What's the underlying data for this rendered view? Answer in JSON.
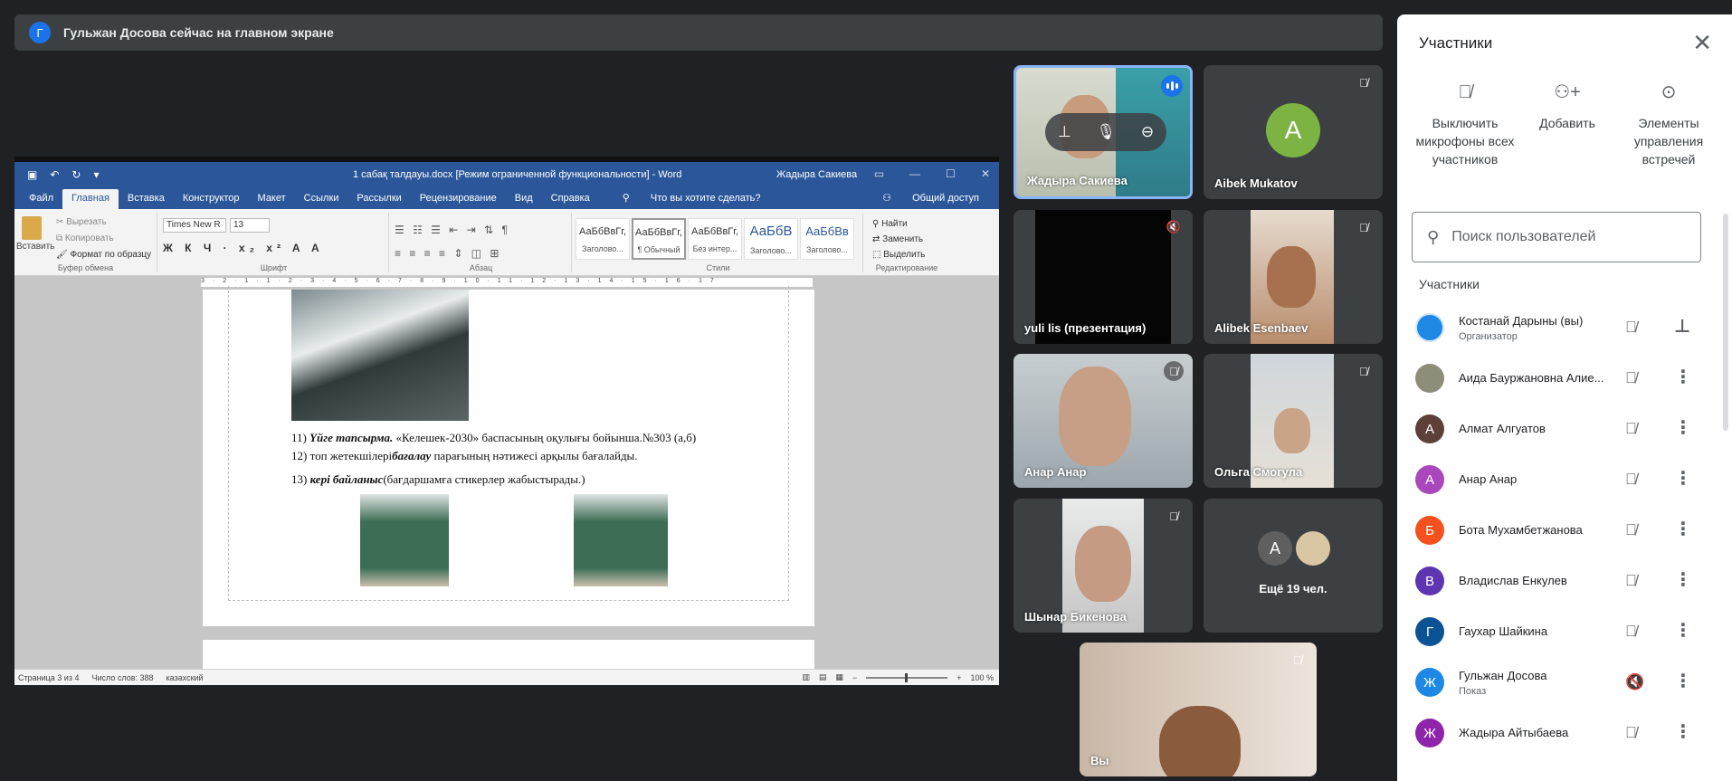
{
  "banner": {
    "avatar_letter": "Г",
    "text": "Гульжан Досова сейчас на главном экране"
  },
  "word": {
    "doc_title": "1 сабақ талдауы.docx [Режим ограниченной функциональности] - Word",
    "user_name": "Жадыра Сакиева",
    "tabs": [
      "Файл",
      "Главная",
      "Вставка",
      "Конструктор",
      "Макет",
      "Ссылки",
      "Рассылки",
      "Рецензирование",
      "Вид",
      "Справка"
    ],
    "tell_me": "Что вы хотите сделать?",
    "share": "Общий доступ",
    "paste_label": "Вставить",
    "cut": "Вырезать",
    "copy": "Копировать",
    "format_painter": "Формат по образцу",
    "clipboard_group": "Буфер обмена",
    "font_name": "Times New R",
    "font_size": "13",
    "font_group": "Шрифт",
    "paragraph_group": "Абзац",
    "styles_group": "Стили",
    "editing_group": "Редактирование",
    "styles": [
      {
        "preview": "АаБбВвГг,",
        "name": "Заголово..."
      },
      {
        "preview": "АаБбВвГг,",
        "name": "¶ Обычный"
      },
      {
        "preview": "АаБбВвГг,",
        "name": "Без интер..."
      },
      {
        "preview": "АаБбВ",
        "name": "Заголово..."
      },
      {
        "preview": "АаБбВв",
        "name": "Заголово..."
      }
    ],
    "find": "Найти",
    "replace": "Заменить",
    "select": "Выделить",
    "lines": [
      {
        "num": "11)",
        "bold": "Үйге тапсырма.",
        "rest": " «Келешек-2030» баспасының оқулығы бойынша.№303 (а,б)"
      },
      {
        "num": "12)",
        "bold": "",
        "plain_before": " топ жетекшілері",
        "bold_mid": "бағалау",
        "rest": " парағының нәтижесі арқылы бағалайды."
      },
      {
        "num": "13)",
        "bold": "кері байланыс",
        "rest": "(бағдаршамға стикерлер жабыстырады.)"
      }
    ],
    "status_page": "Страница 3 из 4",
    "status_words": "Число слов: 388",
    "status_lang": "казахский",
    "zoom": "100 %"
  },
  "tiles": [
    {
      "name": "Жадыра Сакиева"
    },
    {
      "name": "Aibek Mukatov",
      "avatar": "A"
    },
    {
      "name": "yuli lis (презентация)"
    },
    {
      "name": "Alibek Esenbaev"
    },
    {
      "name": "Анар Анар"
    },
    {
      "name": "Ольга Смогула"
    },
    {
      "name": "Шынар Бикенова"
    },
    {
      "name": "Ещё 19 чел.",
      "avatar": "А"
    },
    {
      "name": "Вы"
    }
  ],
  "panel": {
    "title": "Участники",
    "actions": [
      {
        "label": "Выключить микрофоны всех участников"
      },
      {
        "label": "Добавить"
      },
      {
        "label": "Элементы управления встречей"
      }
    ],
    "search_placeholder": "Поиск пользователей",
    "section": "Участники",
    "participants": [
      {
        "name": "Костанай Дарыны (вы)",
        "sub": "Организатор",
        "avatar": "",
        "color": "#1e88e5"
      },
      {
        "name": "Аида Бауржановна Алие...",
        "sub": "",
        "avatar": "",
        "color": "#8d8d7a"
      },
      {
        "name": "Алмат Алгуатов",
        "sub": "",
        "avatar": "А",
        "color": "#5d4037"
      },
      {
        "name": "Анар Анар",
        "sub": "",
        "avatar": "А",
        "color": "#ab47bc"
      },
      {
        "name": "Бота Мухамбетжанова",
        "sub": "",
        "avatar": "Б",
        "color": "#f4511e"
      },
      {
        "name": "Владислав Енкулев",
        "sub": "",
        "avatar": "В",
        "color": "#5e35b1"
      },
      {
        "name": "Гаухар Шайкина",
        "sub": "",
        "avatar": "Г",
        "color": "#0b5394"
      },
      {
        "name": "Гульжан Досова",
        "sub": "Показ",
        "avatar": "Ж",
        "color": "#1e88e5"
      },
      {
        "name": "Жадыра Айтыбаева",
        "sub": "",
        "avatar": "Ж",
        "color": "#8e24aa"
      }
    ]
  }
}
